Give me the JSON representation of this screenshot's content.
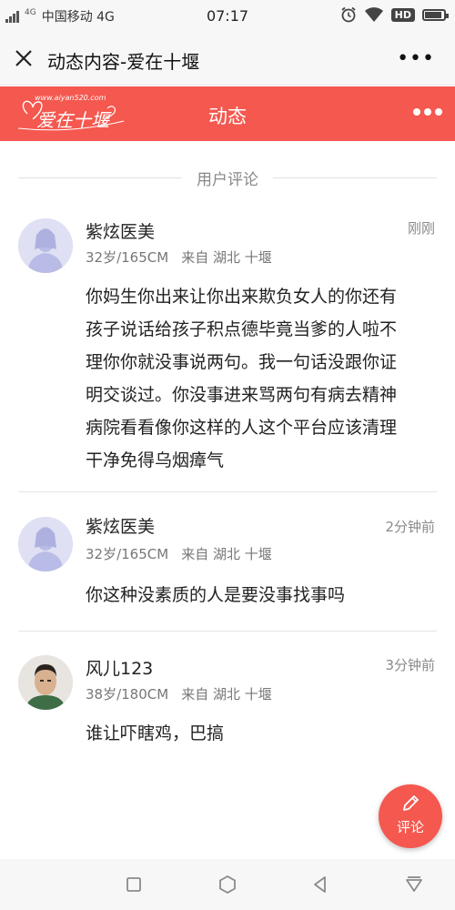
{
  "status_bar": {
    "network_tag": "4G",
    "carrier": "中国移动 4G",
    "time": "07:17",
    "hd_badge": "HD",
    "icons": [
      "alarm-icon",
      "wifi-icon",
      "battery-icon"
    ]
  },
  "webview_title": {
    "title": "动态内容-爱在十堰",
    "more_label": "•••",
    "close_icon": "close-icon"
  },
  "site_header": {
    "logo_url_text": "www.aiyan520.com",
    "logo_text": "爱在十堰",
    "title": "动态",
    "accent_color": "#f4584f"
  },
  "section": {
    "title": "用户评论"
  },
  "comments": [
    {
      "name": "紫炫医美",
      "time": "刚刚",
      "age_height": "32岁/165CM",
      "location": "来自 湖北 十堰",
      "avatar": "default-avatar",
      "text_lines": [
        "你妈生你出来让你出来欺负女人的你还有",
        "孩子说话给孩子积点德毕竟当爹的人啦不",
        "理你你就没事说两句。我一句话没跟你证",
        "明交谈过。你没事进来骂两句有病去精神",
        "病院看看像你这样的人这个平台应该清理",
        "干净免得乌烟瘴气"
      ]
    },
    {
      "name": "紫炫医美",
      "time": "2分钟前",
      "age_height": "32岁/165CM",
      "location": "来自 湖北 十堰",
      "avatar": "default-avatar",
      "text_lines": [
        "你这种没素质的人是要没事找事吗"
      ]
    },
    {
      "name": "风儿123",
      "time": "3分钟前",
      "age_height": "38岁/180CM",
      "location": "来自 湖北 十堰",
      "avatar": "photo-avatar",
      "text_lines": [
        "谁让吓瞎鸡，巴搞"
      ]
    }
  ],
  "fab": {
    "label": "评论",
    "icon": "pencil-icon"
  },
  "nav_bar": {
    "buttons": [
      "recent-apps-icon",
      "home-icon",
      "back-icon",
      "notification-icon"
    ]
  }
}
